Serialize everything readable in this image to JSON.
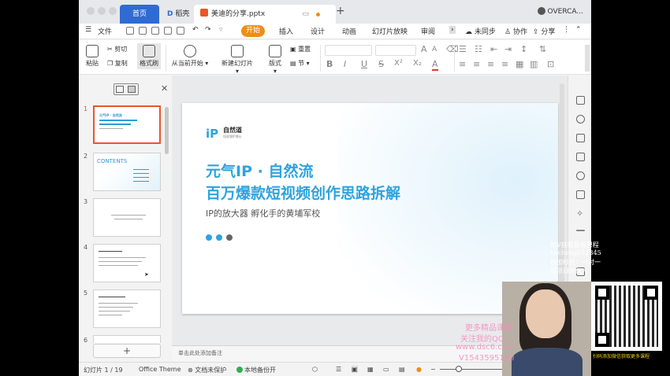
{
  "titlebar": {
    "tab_home": "首页",
    "tab_wps": "稻壳",
    "tab_doc": "美迪的分享.pptx",
    "new_tab": "+",
    "user": "OVERCA..."
  },
  "menubar": {
    "file": "文件",
    "start": "开始",
    "insert": "插入",
    "design": "设计",
    "animation": "动画",
    "slideshow": "幻灯片放映",
    "review": "审阅",
    "unsynced": "未同步",
    "collab": "协作",
    "share": "分享"
  },
  "ribbon": {
    "paste": "粘贴",
    "cut": "剪切",
    "copy": "复制",
    "format_painter": "格式刷",
    "from_current": "从当前开始",
    "new_slide": "新建幻灯片",
    "layout": "版式",
    "section": "节",
    "reset": "重置",
    "font_size_up": "A",
    "font_size_down": "A",
    "bold": "B",
    "italic": "I",
    "underline": "U",
    "strike": "S",
    "superscript": "X²",
    "subscript": "X₂",
    "font_color": "A"
  },
  "thumbnails": [
    {
      "num": "1",
      "title": "元气IP · 自然流",
      "selected": true
    },
    {
      "num": "2",
      "title": "CONTENTS",
      "selected": false
    },
    {
      "num": "3",
      "title": "",
      "selected": false
    },
    {
      "num": "4",
      "title": "",
      "selected": false
    },
    {
      "num": "5",
      "title": "",
      "selected": false
    },
    {
      "num": "6",
      "title": "",
      "selected": false
    }
  ],
  "add_slide": "+",
  "slide": {
    "logo_text": "自然道",
    "logo_sub": "短视频IP增长",
    "title_line1": "元气IP · 自然流",
    "title_line2": "百万爆款短视频创作思路拆解",
    "subtitle": "IP的放大器  孵化手的黄埔军校",
    "dot_colors": [
      "#2ea3de",
      "#2ea3de",
      "#666666"
    ]
  },
  "notes_placeholder": "单击此处添加备注",
  "statusbar": {
    "slide_count": "幻灯片 1 / 19",
    "theme": "Office Theme",
    "protect": "文档未保护",
    "backup": "本地备份开"
  },
  "overlay": {
    "line1": "加V获取最新课程",
    "line2": "kecheng012345",
    "line3": "秒加秒送！一对一",
    "line4": "招项目合伙人",
    "pink1": "更多精品课程",
    "pink2": "关注我的QQ",
    "pink3": "www.dsc6.com",
    "pink4": "V1543595160",
    "qr_caption": "扫码添加微信获取更多课程"
  },
  "colors": {
    "accent_blue": "#2f6bd3",
    "start_orange": "#f08c1a",
    "slide_blue": "#2ea3de",
    "ppt_red": "#e8562a"
  }
}
